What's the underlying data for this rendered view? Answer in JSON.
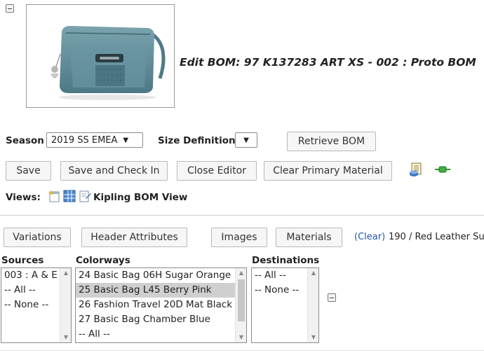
{
  "page": {
    "edit_title": "Edit BOM: 97 K137283 ART XS - 002 : Proto BOM"
  },
  "season": {
    "label": "Season",
    "value": "2019 SS EMEA",
    "size_def_label": "Size Definition",
    "size_def_value": "",
    "retrieve_label": "Retrieve BOM"
  },
  "toolbar": {
    "save": "Save",
    "save_checkin": "Save and Check In",
    "close_editor": "Close Editor",
    "clear_primary": "Clear Primary Material"
  },
  "views": {
    "label": "Views:",
    "current": "Kipling BOM View"
  },
  "tabs": {
    "variations": "Variations",
    "header_attributes": "Header Attributes",
    "images": "Images",
    "materials": "Materials",
    "clear_link": "(Clear)",
    "selected_material": "190 / Red Leather Su"
  },
  "filters": {
    "sources": {
      "header": "Sources",
      "options": [
        "003 : A & E",
        "-- All --",
        "-- None --"
      ]
    },
    "colorways": {
      "header": "Colorways",
      "options": [
        "24 Basic Bag 06H Sugar Orange",
        "25 Basic Bag L45 Berry Pink",
        "26 Fashion Travel 20D Mat Black",
        "27 Basic Bag Chamber Blue",
        "-- All --"
      ]
    },
    "destinations": {
      "header": "Destinations",
      "options": [
        "-- All --",
        "-- None --"
      ]
    }
  },
  "colors": {
    "bag": "#5f8b98",
    "selected_bg": "#cfcfcf",
    "link": "#2255aa"
  }
}
